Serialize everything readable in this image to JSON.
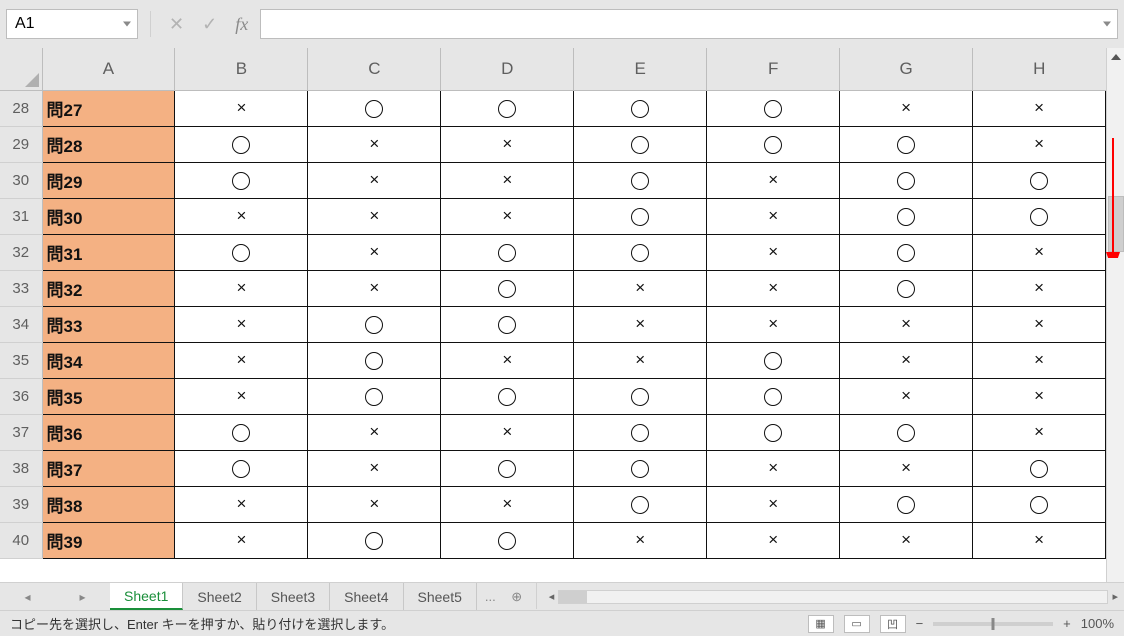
{
  "name_box": {
    "value": "A1"
  },
  "formula_bar": {
    "value": ""
  },
  "fx_buttons": {
    "cancel": "✕",
    "confirm": "✓",
    "fx": "fx"
  },
  "columns": [
    "A",
    "B",
    "C",
    "D",
    "E",
    "F",
    "G",
    "H"
  ],
  "rows": [
    {
      "num": "28",
      "label": "問27",
      "cells": [
        "×",
        "○",
        "○",
        "○",
        "○",
        "×",
        "×"
      ]
    },
    {
      "num": "29",
      "label": "問28",
      "cells": [
        "○",
        "×",
        "×",
        "○",
        "○",
        "○",
        "×"
      ]
    },
    {
      "num": "30",
      "label": "問29",
      "cells": [
        "○",
        "×",
        "×",
        "○",
        "×",
        "○",
        "○"
      ]
    },
    {
      "num": "31",
      "label": "問30",
      "cells": [
        "×",
        "×",
        "×",
        "○",
        "×",
        "○",
        "○"
      ]
    },
    {
      "num": "32",
      "label": "問31",
      "cells": [
        "○",
        "×",
        "○",
        "○",
        "×",
        "○",
        "×"
      ]
    },
    {
      "num": "33",
      "label": "問32",
      "cells": [
        "×",
        "×",
        "○",
        "×",
        "×",
        "○",
        "×"
      ]
    },
    {
      "num": "34",
      "label": "問33",
      "cells": [
        "×",
        "○",
        "○",
        "×",
        "×",
        "×",
        "×"
      ]
    },
    {
      "num": "35",
      "label": "問34",
      "cells": [
        "×",
        "○",
        "×",
        "×",
        "○",
        "×",
        "×"
      ]
    },
    {
      "num": "36",
      "label": "問35",
      "cells": [
        "×",
        "○",
        "○",
        "○",
        "○",
        "×",
        "×"
      ]
    },
    {
      "num": "37",
      "label": "問36",
      "cells": [
        "○",
        "×",
        "×",
        "○",
        "○",
        "○",
        "×"
      ]
    },
    {
      "num": "38",
      "label": "問37",
      "cells": [
        "○",
        "×",
        "○",
        "○",
        "×",
        "×",
        "○"
      ]
    },
    {
      "num": "39",
      "label": "問38",
      "cells": [
        "×",
        "×",
        "×",
        "○",
        "×",
        "○",
        "○"
      ]
    },
    {
      "num": "40",
      "label": "問39",
      "cells": [
        "×",
        "○",
        "○",
        "×",
        "×",
        "×",
        "×"
      ]
    }
  ],
  "sheet_tabs": [
    "Sheet1",
    "Sheet2",
    "Sheet3",
    "Sheet4",
    "Sheet5"
  ],
  "sheet_tabs_more": "...",
  "active_tab_index": 0,
  "status_message": "コピー先を選択し、Enter キーを押すか、貼り付けを選択します。",
  "zoom_text": "100%",
  "view_icons": {
    "normal": "▦",
    "page_layout": "▭",
    "page_break": "凹"
  },
  "zoom_controls": {
    "minus": "−",
    "plus": "+"
  }
}
